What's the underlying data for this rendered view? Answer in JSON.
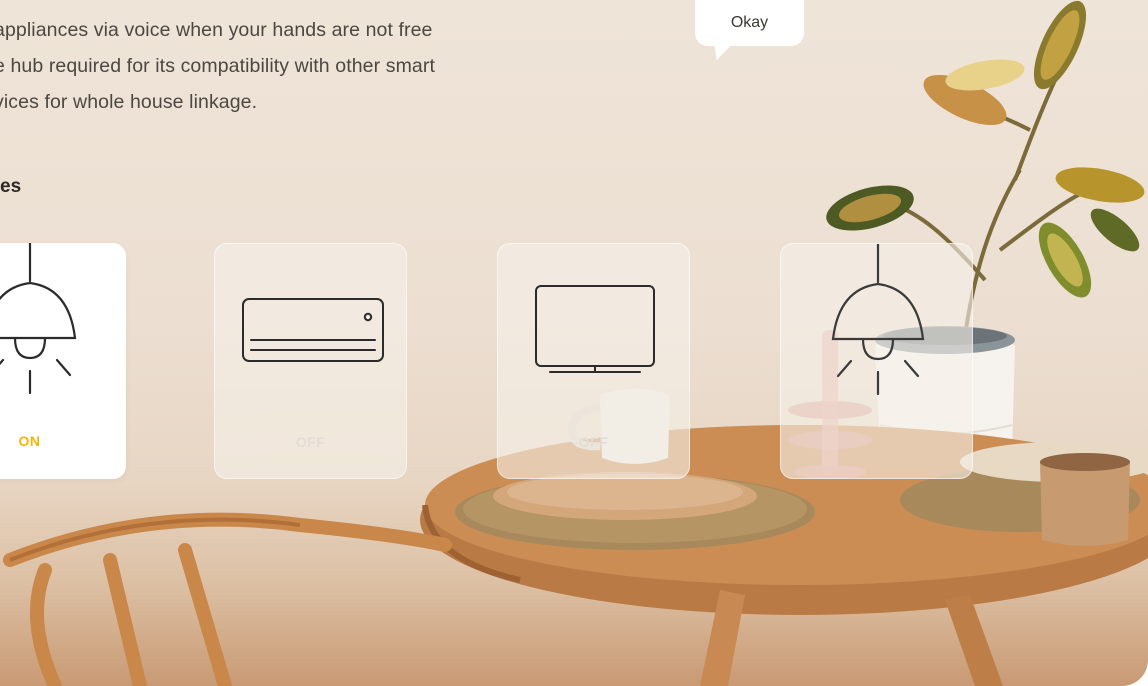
{
  "description_text": "appliances via voice when your hands are not free\ne hub required for its compatibility with other smart\nvices for whole house linkage.",
  "section_title": "es",
  "bubble": {
    "label": "Okay"
  },
  "devices": [
    {
      "type": "ceiling-lamp",
      "state": "ON",
      "active": true
    },
    {
      "type": "air-conditioner",
      "state": "OFF",
      "active": false
    },
    {
      "type": "television",
      "state": "OFF",
      "active": false
    },
    {
      "type": "ceiling-lamp",
      "state": "",
      "active": false
    }
  ],
  "colors": {
    "on_state": "#f2b705",
    "off_state": "#e2ddd6",
    "icon_stroke": "#2b2b2b",
    "background_top": "#efe4d8",
    "background_bottom": "#c99a74"
  }
}
